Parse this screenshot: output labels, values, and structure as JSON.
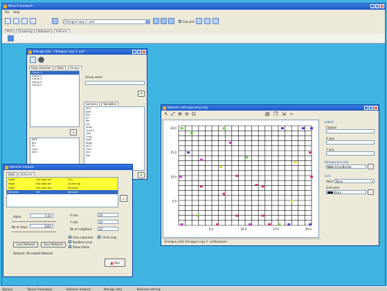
{
  "main": {
    "title": "Neuro Framework",
    "menu": [
      "File",
      "Help"
    ],
    "project_select": "(Tenogue copy 2 .out)",
    "tab_labels": [
      "PCA",
      "Clustering",
      "Kohonen",
      "Softness"
    ],
    "sub_label": "Sub plot"
  },
  "manage_win": {
    "title": "Manage data - [Tenogue copy 2 .out]",
    "tabs": [
      "Data selection",
      "Stats",
      "Groups"
    ],
    "groups": [
      "Group 1",
      "Group 2",
      "Group 3",
      "Group 4",
      "Group 5"
    ],
    "variables": [
      "BMF",
      "Bra",
      "Eri",
      "Cera",
      "Siler"
    ],
    "group_name_label": "Group name",
    "samples_tabs": [
      "Samples",
      "Variables"
    ],
    "samples": [
      "Juni",
      "BMF",
      "Bra",
      "Eri",
      "Per",
      "Fra",
      "Buse",
      "2019.1",
      "Holl",
      "Chun",
      "Swill",
      "Rage",
      "pt11",
      "Golv",
      "Jina",
      "Nai"
    ]
  },
  "kohonen_win": {
    "title": "Kohonen network",
    "tabs": [
      "Data",
      "Kohonen"
    ],
    "table": [
      [
        "Head",
        "Full data set",
        "PCA"
      ],
      [
        "Head",
        "Full data set",
        "Clustering"
      ],
      [
        "Head",
        "Full data set",
        "Kohonen"
      ],
      [
        "Kohonen",
        "Set",
        "Kohonen"
      ]
    ],
    "alpha_label": "Alpha",
    "alpha_value": "0.40",
    "nb_steps_label": "Nb of steps",
    "nb_steps_value": "1000",
    "xsize_label": "X size",
    "xsize_value": "20",
    "ysize_label": "Y size",
    "ysize_value": "20",
    "neighbors_label": "Nb of neighbors",
    "neighbors_value": "20",
    "view_sep_label": "View separator",
    "circle_map_label": "Circle map",
    "realtime_label": "Realtime view",
    "show_labels_label": "Show labels",
    "load_btn": "Load Network",
    "save_btn": "Save Network",
    "network_status": "Network: No loaded Network",
    "run_btn": "Run"
  },
  "kmap_win": {
    "title": "Kohonen self-organizing map",
    "labels_title": "Labels",
    "caption_label": "Caption",
    "xaxis_label": "X axis",
    "yaxis_label": "Y axis",
    "bg_color_label": "Background color",
    "bg_color_value": "ActiveBorder",
    "grid_label": "Grid",
    "style_label": "Style",
    "style_value": "None",
    "grid_color_label": "Grid color",
    "grid_color_value": "Black",
    "status": "(tenogue_leet) [tenogue copy 2 .out]kohonen",
    "yticks": [
      "20.0",
      "15.0",
      "10.0",
      "5.0"
    ],
    "xticks": [
      "5.0",
      "10.0",
      "15.0",
      "20.0"
    ],
    "points": [
      {
        "x": 0.5,
        "y": 20.0,
        "c": "#66cc33"
      },
      {
        "x": 7.0,
        "y": 20.0,
        "c": "#66cc33"
      },
      {
        "x": 16.0,
        "y": 20.0,
        "c": "#6633cc"
      },
      {
        "x": 19.2,
        "y": 20.0,
        "c": "#6633cc"
      },
      {
        "x": 20.5,
        "y": 20.0,
        "c": "#6633cc"
      },
      {
        "x": 2.0,
        "y": 19.0,
        "c": "#66cc33"
      },
      {
        "x": 8.0,
        "y": 17.0,
        "c": "#cc33cc"
      },
      {
        "x": 1.5,
        "y": 15.0,
        "c": "#6633cc"
      },
      {
        "x": 20.3,
        "y": 15.0,
        "c": "#cc3366"
      },
      {
        "x": 10.5,
        "y": 14.0,
        "c": "#66cc33"
      },
      {
        "x": 3.5,
        "y": 13.5,
        "c": "#cc33cc"
      },
      {
        "x": 18.0,
        "y": 13.0,
        "c": "#dddd33"
      },
      {
        "x": 6.5,
        "y": 12.0,
        "c": "#dddd33"
      },
      {
        "x": 0.3,
        "y": 10.0,
        "c": "#cc33cc"
      },
      {
        "x": 9.0,
        "y": 10.2,
        "c": "#cc3366"
      },
      {
        "x": 20.5,
        "y": 10.0,
        "c": "#cc3366"
      },
      {
        "x": 3.5,
        "y": 8.0,
        "c": "#cc3366"
      },
      {
        "x": 12.0,
        "y": 8.3,
        "c": "#cc3366"
      },
      {
        "x": 13.0,
        "y": 8.0,
        "c": "#cc3366"
      },
      {
        "x": 7.0,
        "y": 6.5,
        "c": "#cc3366"
      },
      {
        "x": 17.5,
        "y": 5.0,
        "c": "#dddd33"
      },
      {
        "x": 3.0,
        "y": 2.0,
        "c": "#66cc33"
      },
      {
        "x": 9.0,
        "y": 2.0,
        "c": "#cc3366"
      },
      {
        "x": 13.0,
        "y": 2.0,
        "c": "#cc3366"
      },
      {
        "x": 0.5,
        "y": 0.2,
        "c": "#cc33cc"
      },
      {
        "x": 6.0,
        "y": 0.2,
        "c": "#cc3366"
      },
      {
        "x": 11.0,
        "y": 0.2,
        "c": "#cc33cc"
      },
      {
        "x": 14.0,
        "y": 0.2,
        "c": "#cc3366"
      },
      {
        "x": 15.5,
        "y": 0.2,
        "c": "#66cc33"
      },
      {
        "x": 17.0,
        "y": 0.2,
        "c": "#6633cc"
      },
      {
        "x": 20.3,
        "y": 0.2,
        "c": "#6633cc"
      }
    ]
  },
  "taskbar": [
    "Bureau",
    "Neuro Framework",
    "Kohonen network",
    "Manage data",
    "Kohonen self-org"
  ]
}
